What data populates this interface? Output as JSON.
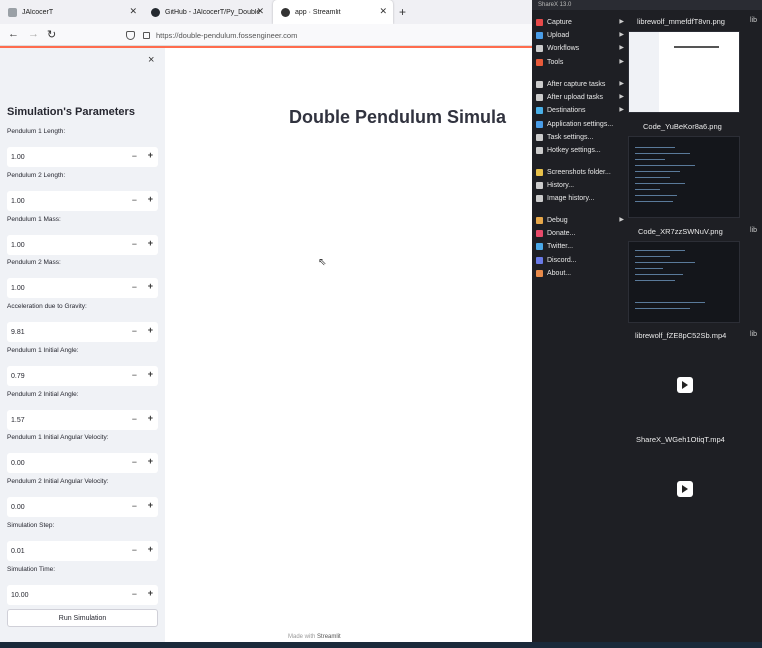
{
  "browser": {
    "tabs": [
      {
        "title": "JAlcocerT"
      },
      {
        "title": "GitHub - JAlcocerT/Py_Doublé"
      },
      {
        "title": "app · Streamlit"
      }
    ],
    "new_tab": "+",
    "url": "https://double-pendulum.fossengineer.com"
  },
  "sidebar": {
    "close": "×",
    "title": "Simulation's Parameters",
    "params": [
      {
        "label": "Pendulum 1 Length:",
        "value": "1.00"
      },
      {
        "label": "Pendulum 2 Length:",
        "value": "1.00"
      },
      {
        "label": "Pendulum 1 Mass:",
        "value": "1.00"
      },
      {
        "label": "Pendulum 2 Mass:",
        "value": "1.00"
      },
      {
        "label": "Acceleration due to Gravity:",
        "value": "9.81"
      },
      {
        "label": "Pendulum 1 Initial Angle:",
        "value": "0.79"
      },
      {
        "label": "Pendulum 2 Initial Angle:",
        "value": "1.57"
      },
      {
        "label": "Pendulum 1 Initial Angular Velocity:",
        "value": "0.00"
      },
      {
        "label": "Pendulum 2 Initial Angular Velocity:",
        "value": "0.00"
      },
      {
        "label": "Simulation Step:",
        "value": "0.01"
      },
      {
        "label": "Simulation Time:",
        "value": "10.00"
      }
    ],
    "minus": "−",
    "plus": "+",
    "run_button": "Run Simulation"
  },
  "main": {
    "title": "Double Pendulum Simula",
    "footer_prefix": "Made with",
    "footer_brand": "Streamlit"
  },
  "sharex": {
    "header": "ShareX 13.0",
    "menu": [
      {
        "label": "Capture",
        "icon": "capture-icon",
        "color": "#e84a4a",
        "submenu": true
      },
      {
        "label": "Upload",
        "icon": "upload-icon",
        "color": "#4a9de8",
        "submenu": true
      },
      {
        "label": "Workflows",
        "icon": "workflows-icon",
        "color": "#cccccc",
        "submenu": true
      },
      {
        "label": "Tools",
        "icon": "tools-icon",
        "color": "#e85a3a",
        "submenu": true
      },
      {
        "label": "After capture tasks",
        "icon": "after-capture-icon",
        "color": "#cccccc",
        "submenu": true
      },
      {
        "label": "After upload tasks",
        "icon": "after-upload-icon",
        "color": "#cccccc",
        "submenu": true
      },
      {
        "label": "Destinations",
        "icon": "destinations-icon",
        "color": "#4ab0e8",
        "submenu": true
      },
      {
        "label": "Application settings...",
        "icon": "app-settings-icon",
        "color": "#4a9de8",
        "submenu": false
      },
      {
        "label": "Task settings...",
        "icon": "task-settings-icon",
        "color": "#cccccc",
        "submenu": false
      },
      {
        "label": "Hotkey settings...",
        "icon": "hotkey-icon",
        "color": "#cccccc",
        "submenu": false
      },
      {
        "label": "Screenshots folder...",
        "icon": "folder-icon",
        "color": "#e8c14a",
        "submenu": false
      },
      {
        "label": "History...",
        "icon": "history-icon",
        "color": "#cccccc",
        "submenu": false
      },
      {
        "label": "Image history...",
        "icon": "image-history-icon",
        "color": "#cccccc",
        "submenu": false
      },
      {
        "label": "Debug",
        "icon": "debug-icon",
        "color": "#e8a84a",
        "submenu": true
      },
      {
        "label": "Donate...",
        "icon": "donate-icon",
        "color": "#e84a6a",
        "submenu": false
      },
      {
        "label": "Twitter...",
        "icon": "twitter-icon",
        "color": "#4aa8e8",
        "submenu": false
      },
      {
        "label": "Discord...",
        "icon": "discord-icon",
        "color": "#6a7ae8",
        "submenu": false
      },
      {
        "label": "About...",
        "icon": "about-icon",
        "color": "#e88a4a",
        "submenu": false
      }
    ],
    "files": [
      "librewolf_mmefdfT8vn.png",
      "Code_YuBeKor8a6.png",
      "Code_XR7zzSWNuV.png",
      "librewolf_fZE8pC52Sb.mp4",
      "ShareX_WGeh1OtiqT.mp4"
    ],
    "side_labels": [
      "lib",
      "lib",
      "lib"
    ]
  }
}
